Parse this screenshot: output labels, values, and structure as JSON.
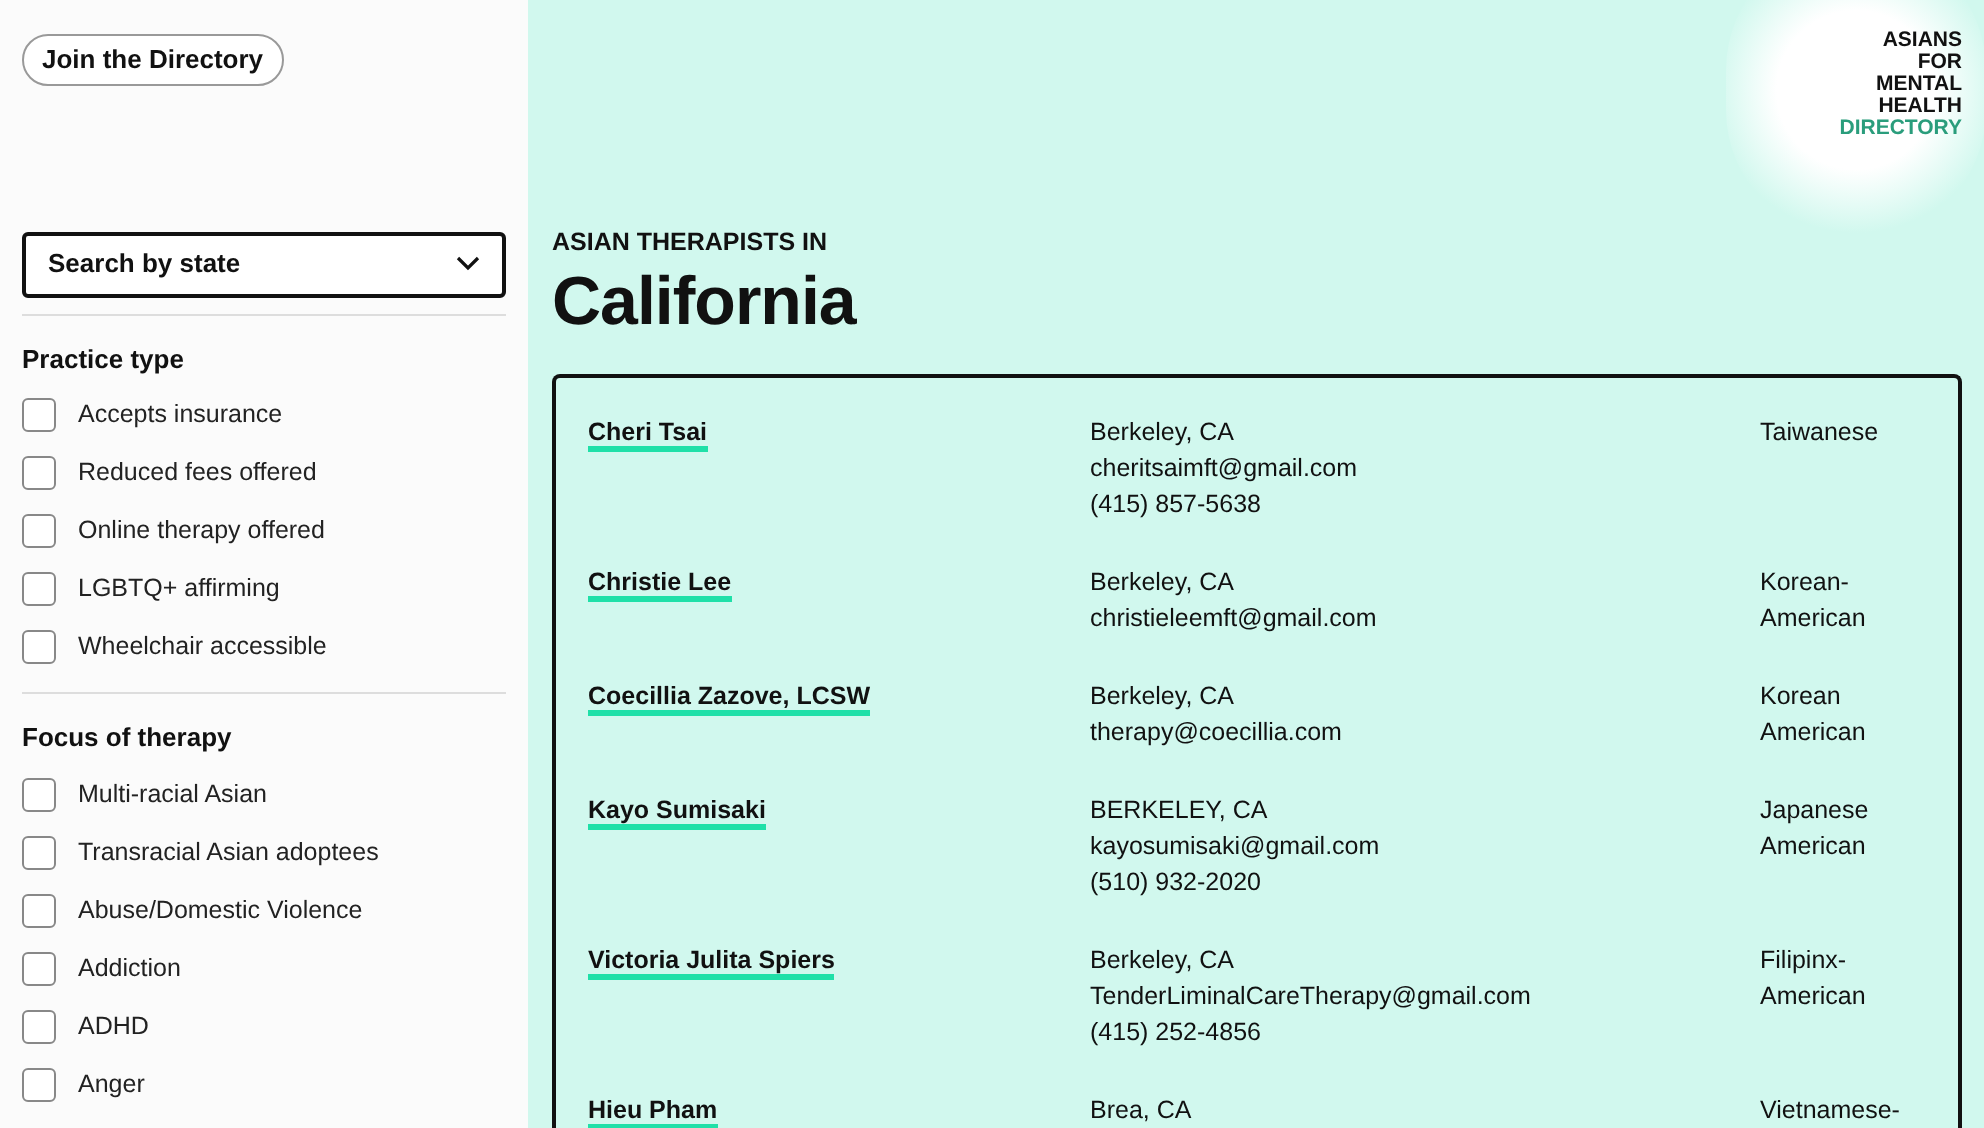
{
  "sidebar": {
    "join_button": "Join the Directory",
    "state_select": {
      "placeholder": "Search by state"
    },
    "filter_groups": [
      {
        "title": "Practice type",
        "options": [
          {
            "label": "Accepts insurance",
            "checked": false
          },
          {
            "label": "Reduced fees offered",
            "checked": false
          },
          {
            "label": "Online therapy offered",
            "checked": false
          },
          {
            "label": "LGBTQ+ affirming",
            "checked": false
          },
          {
            "label": "Wheelchair accessible",
            "checked": false
          }
        ]
      },
      {
        "title": "Focus of therapy",
        "options": [
          {
            "label": "Multi-racial Asian",
            "checked": false
          },
          {
            "label": "Transracial Asian adoptees",
            "checked": false
          },
          {
            "label": "Abuse/Domestic Violence",
            "checked": false
          },
          {
            "label": "Addiction",
            "checked": false
          },
          {
            "label": "ADHD",
            "checked": false
          },
          {
            "label": "Anger",
            "checked": false
          }
        ]
      }
    ]
  },
  "logo": {
    "lines": [
      "ASIANS",
      "FOR",
      "MENTAL",
      "HEALTH"
    ],
    "accent": "DIRECTORY"
  },
  "heading": {
    "eyebrow": "ASIAN THERAPISTS IN",
    "title": "California"
  },
  "therapists": [
    {
      "name": "Cheri Tsai",
      "location": "Berkeley, CA",
      "email": "cheritsaimft@gmail.com",
      "phone": "(415) 857-5638",
      "ethnicity": "Taiwanese"
    },
    {
      "name": "Christie Lee",
      "location": "Berkeley, CA",
      "email": "christieleemft@gmail.com",
      "ethnicity": "Korean-American"
    },
    {
      "name": "Coecillia Zazove, LCSW",
      "location": "Berkeley, CA",
      "email": "therapy@coecillia.com",
      "ethnicity": "Korean American"
    },
    {
      "name": "Kayo Sumisaki",
      "location": "BERKELEY, CA",
      "email": "kayosumisaki@gmail.com",
      "phone": "(510) 932-2020",
      "ethnicity": "Japanese American"
    },
    {
      "name": "Victoria Julita Spiers",
      "location": "Berkeley, CA",
      "email": "TenderLiminalCareTherapy@gmail.com",
      "phone": "(415) 252-4856",
      "ethnicity": "Filipinx-American"
    },
    {
      "name": "Hieu Pham",
      "location": "Brea, CA",
      "ethnicity": "Vietnamese-"
    }
  ]
}
